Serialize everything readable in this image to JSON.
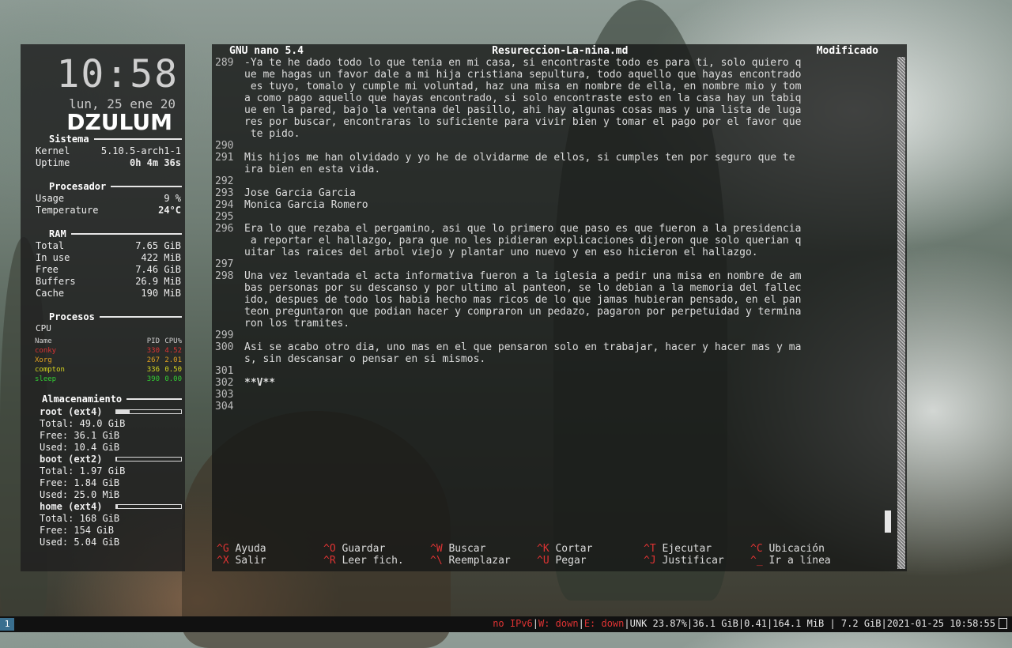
{
  "conky": {
    "clock": "10:58",
    "date": "lun, 25 ene 20",
    "host": "DZULUM",
    "sistema": {
      "head": "Sistema",
      "kernel_label": "Kernel",
      "kernel": "5.10.5-arch1-1",
      "uptime_label": "Uptime",
      "uptime": "0h 4m 36s"
    },
    "procesador": {
      "head": "Procesador",
      "usage_label": "Usage",
      "usage": "9 %",
      "temp_label": "Temperature",
      "temp": "24°C"
    },
    "ram": {
      "head": "RAM",
      "rows": [
        {
          "label": "Total",
          "value": "7.65 GiB"
        },
        {
          "label": "In use",
          "value": "422 MiB"
        },
        {
          "label": "Free",
          "value": "7.46 GiB"
        },
        {
          "label": "Buffers",
          "value": "26.9 MiB"
        },
        {
          "label": "Cache",
          "value": "190 MiB"
        }
      ]
    },
    "procesos": {
      "head": "Procesos",
      "sub": "CPU",
      "cols": [
        "Name",
        "PID",
        "CPU%"
      ],
      "rows": [
        {
          "name": "conky",
          "pid": "330",
          "cpu": "4.52",
          "color": "#d33"
        },
        {
          "name": "Xorg",
          "pid": "267",
          "cpu": "2.01",
          "color": "#e0a020"
        },
        {
          "name": "compton",
          "pid": "336",
          "cpu": "0.50",
          "color": "#d8d820"
        },
        {
          "name": "sleep",
          "pid": "390",
          "cpu": "0.00",
          "color": "#3c3"
        }
      ]
    },
    "almacenamiento": {
      "head": "Almacenamiento",
      "disks": [
        {
          "name": "root (ext4)",
          "total": "Total: 49.0 GiB",
          "free": "Free: 36.1 GiB",
          "used": "Used: 10.4 GiB",
          "fill": 0.21
        },
        {
          "name": "boot (ext2)",
          "total": "Total: 1.97 GiB",
          "free": "Free: 1.84 GiB",
          "used": "Used: 25.0 MiB",
          "fill": 0.01
        },
        {
          "name": "home (ext4)",
          "total": "Total: 168 GiB",
          "free": "Free: 154 GiB",
          "used": "Used: 5.04 GiB",
          "fill": 0.03
        }
      ]
    }
  },
  "nano": {
    "version": "GNU nano 5.4",
    "filename": "Resureccion-La-nina.md",
    "state": "Modificado",
    "lines": [
      {
        "n": "289",
        "t": "-Ya te he dado todo lo que tenia en mi casa, si encontraste todo es para ti, solo quiero q"
      },
      {
        "n": "",
        "t": "ue me hagas un favor dale a mi hija cristiana sepultura, todo aquello que hayas encontrado"
      },
      {
        "n": "",
        "t": " es tuyo, tomalo y cumple mi voluntad, haz una misa en nombre de ella, en nombre mio y tom"
      },
      {
        "n": "",
        "t": "a como pago aquello que hayas encontrado, si solo encontraste esto en la casa hay un tabiq"
      },
      {
        "n": "",
        "t": "ue en la pared, bajo la ventana del pasillo, ahi hay algunas cosas mas y una lista de luga"
      },
      {
        "n": "",
        "t": "res por buscar, encontraras lo suficiente para vivir bien y tomar el pago por el favor que"
      },
      {
        "n": "",
        "t": " te pido."
      },
      {
        "n": "290",
        "t": ""
      },
      {
        "n": "291",
        "t": "Mis hijos me han olvidado y yo he de olvidarme de ellos, si cumples ten por seguro que te"
      },
      {
        "n": "",
        "t": "ira bien en esta vida."
      },
      {
        "n": "292",
        "t": ""
      },
      {
        "n": "293",
        "t": "Jose Garcia Garcia"
      },
      {
        "n": "294",
        "t": "Monica Garcia Romero"
      },
      {
        "n": "295",
        "t": ""
      },
      {
        "n": "296",
        "t": "Era lo que rezaba el pergamino, asi que lo primero que paso es que fueron a la presidencia"
      },
      {
        "n": "",
        "t": " a reportar el hallazgo, para que no les pidieran explicaciones dijeron que solo querian q"
      },
      {
        "n": "",
        "t": "uitar las raices del arbol viejo y plantar uno nuevo y en eso hicieron el hallazgo."
      },
      {
        "n": "297",
        "t": ""
      },
      {
        "n": "298",
        "t": "Una vez levantada el acta informativa fueron a la iglesia a pedir una misa en nombre de am"
      },
      {
        "n": "",
        "t": "bas personas por su descanso y por ultimo al panteon, se lo debian a la memoria del fallec"
      },
      {
        "n": "",
        "t": "ido, despues de todo los habia hecho mas ricos de lo que jamas hubieran pensado, en el pan"
      },
      {
        "n": "",
        "t": "teon preguntaron que podian hacer y compraron un pedazo, pagaron por perpetuidad y termina"
      },
      {
        "n": "",
        "t": "ron los tramites."
      },
      {
        "n": "299",
        "t": ""
      },
      {
        "n": "300",
        "t": "Asi se acabo otro dia, uno mas en el que pensaron solo en trabajar, hacer y hacer mas y ma"
      },
      {
        "n": "",
        "t": "s, sin descansar o pensar en si mismos."
      },
      {
        "n": "301",
        "t": ""
      },
      {
        "n": "302",
        "t": "**V**",
        "green": true
      },
      {
        "n": "303",
        "t": ""
      },
      {
        "n": "304",
        "t": ""
      }
    ],
    "help_row1": [
      {
        "k": "^G",
        "l": "Ayuda"
      },
      {
        "k": "^O",
        "l": "Guardar"
      },
      {
        "k": "^W",
        "l": "Buscar"
      },
      {
        "k": "^K",
        "l": "Cortar"
      },
      {
        "k": "^T",
        "l": "Ejecutar"
      },
      {
        "k": "^C",
        "l": "Ubicación"
      }
    ],
    "help_row2": [
      {
        "k": "^X",
        "l": "Salir"
      },
      {
        "k": "^R",
        "l": "Leer fich."
      },
      {
        "k": "^\\",
        "l": "Reemplazar"
      },
      {
        "k": "^U",
        "l": "Pegar"
      },
      {
        "k": "^J",
        "l": "Justificar"
      },
      {
        "k": "^_",
        "l": "Ir a línea"
      }
    ]
  },
  "taskbar": {
    "workspace": "1",
    "ipv6": "no IPv6",
    "wifi": "W: down",
    "eth": "E: down",
    "rest": "UNK 23.87%|36.1 GiB|0.41|164.1 MiB | 7.2 GiB|2021-01-25 10:58:55"
  }
}
